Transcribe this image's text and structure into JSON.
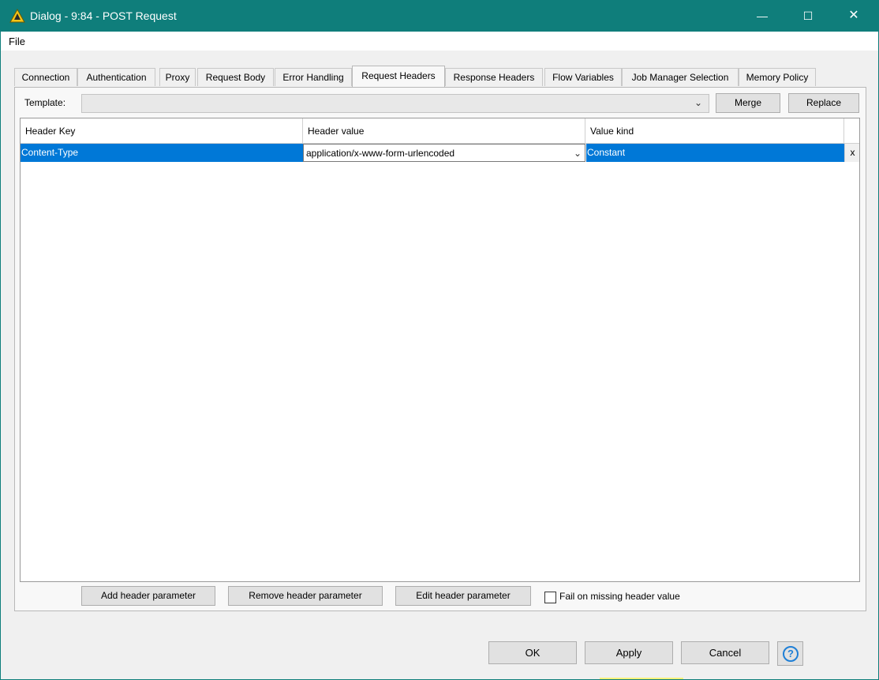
{
  "window": {
    "title": "Dialog - 9:84 - POST Request",
    "app_icon": "knime-triangle-icon",
    "accent": "#0f7e7b",
    "controls": {
      "minimize": "—",
      "maximize": "☐",
      "close": "✕"
    }
  },
  "menu": {
    "file": "File"
  },
  "tabs": [
    {
      "label": "Connection",
      "active": false
    },
    {
      "label": "Authentication",
      "active": false
    },
    {
      "label": "Proxy",
      "active": false
    },
    {
      "label": "Request Body",
      "active": false
    },
    {
      "label": "Error Handling",
      "active": false
    },
    {
      "label": "Request Headers",
      "active": true
    },
    {
      "label": "Response Headers",
      "active": false
    },
    {
      "label": "Flow Variables",
      "active": false
    },
    {
      "label": "Job Manager Selection",
      "active": false
    },
    {
      "label": "Memory Policy",
      "active": false
    }
  ],
  "template": {
    "label": "Template:",
    "value": "",
    "merge_label": "Merge",
    "replace_label": "Replace"
  },
  "table": {
    "columns": [
      "Header Key",
      "Header value",
      "Value kind"
    ],
    "rows": [
      {
        "key": "Content-Type",
        "value": "application/x-www-form-urlencoded",
        "kind": "Constant",
        "delete": "x"
      }
    ],
    "selected_color": "#0078d7"
  },
  "actions": {
    "add": "Add header parameter",
    "remove": "Remove header parameter",
    "edit": "Edit header parameter",
    "fail_missing": "Fail on missing header value",
    "fail_missing_checked": false
  },
  "footer": {
    "ok": "OK",
    "apply": "Apply",
    "cancel": "Cancel",
    "help_icon": "help-icon",
    "help_glyph": "?"
  }
}
